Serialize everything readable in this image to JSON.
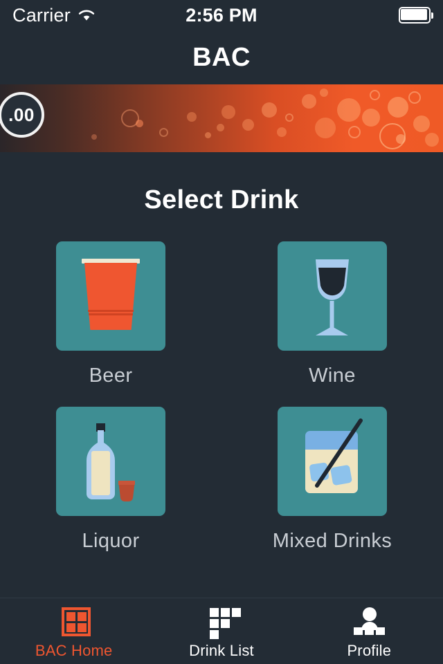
{
  "status_bar": {
    "carrier": "Carrier",
    "wifi_icon": "wifi-icon",
    "time": "2:56 PM",
    "battery_icon": "battery-full-icon"
  },
  "navbar": {
    "title": "BAC"
  },
  "bac_banner": {
    "value": ".00",
    "gradient_start": "#2b2629",
    "gradient_end": "#ef5a26",
    "circle_border": "#f2f2f2"
  },
  "main": {
    "section_title": "Select Drink",
    "tile_color": "#3e8e93",
    "drinks": [
      {
        "label": "Beer",
        "icon": "beer-cup-icon"
      },
      {
        "label": "Wine",
        "icon": "wine-glass-icon"
      },
      {
        "label": "Liquor",
        "icon": "liquor-bottle-icon"
      },
      {
        "label": "Mixed Drinks",
        "icon": "mixed-drink-glass-icon"
      }
    ]
  },
  "tabbar": {
    "active_color": "#ef5630",
    "inactive_color": "#ffffff",
    "tabs": [
      {
        "label": "BAC Home",
        "icon": "grid-home-icon",
        "active": true
      },
      {
        "label": "Drink List",
        "icon": "drink-list-icon",
        "active": false
      },
      {
        "label": "Profile",
        "icon": "profile-person-icon",
        "active": false
      }
    ]
  }
}
